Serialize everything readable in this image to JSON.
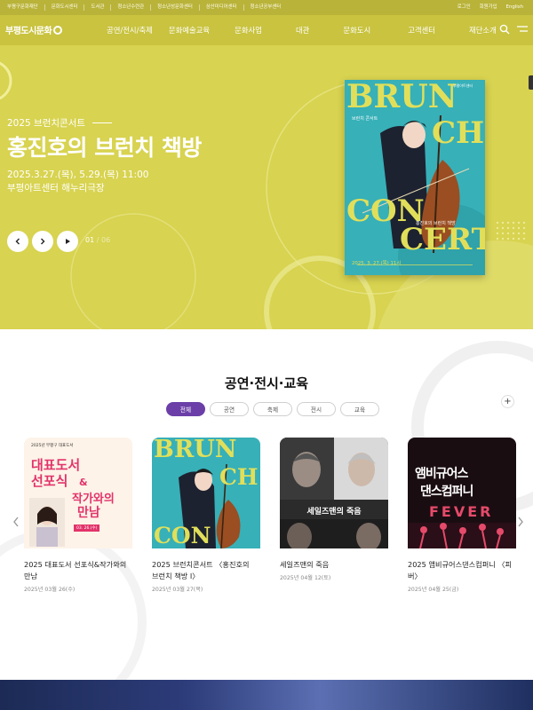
{
  "util_bar": {
    "left_links": [
      "부평구문화재단",
      "문화도시센터",
      "도서관",
      "청소년수련관",
      "청소년성문화센터",
      "삼산미디어센터",
      "청소년공부센터"
    ],
    "right_links": [
      "로그인",
      "회원가입",
      "English"
    ]
  },
  "nav": {
    "logo_text": "부평도시문화",
    "menu": [
      "공연/전시/축제",
      "문화예술교육",
      "문화사업",
      "대관",
      "문화도시",
      "고객센터",
      "재단소개"
    ]
  },
  "hero": {
    "subtitle": "2025 브런치콘서트",
    "title": "홍진호의 브런치 책방",
    "date": "2025.3.27.(목), 5.29.(목) 11:00",
    "venue": "부평아트센터 해누리극장",
    "counter_current": "01",
    "counter_total": "/ 06",
    "poster": {
      "big_1": "BRUN",
      "big_2": "CH",
      "big_3": "CON",
      "big_4": "CERT",
      "kicker": "브런치 콘서트",
      "program": "홍진호의 브런치 책방",
      "dates": "2025. 3. 27.(목) 11시",
      "logo": "부평아트센터"
    },
    "colors": {
      "background": "#d8d350",
      "poster_bg": "#37b0b8",
      "poster_text": "#e1df5a"
    }
  },
  "section": {
    "title": "공연·전시·교육",
    "filters": [
      "전체",
      "공연",
      "축제",
      "전시",
      "교육"
    ],
    "active_filter": "전체",
    "active_color": "#6b3fa7",
    "plus": "+",
    "cards": [
      {
        "title": "2025 대표도서 선포식&작가와의 만남",
        "date": "2025년 03월 26(수)",
        "poster": {
          "top": "2025년 부평구 대표도서",
          "l1": "대표도서",
          "l2": "선포식",
          "l3": "&",
          "l4": "작가와의",
          "l5": "만남",
          "date_chip": "03. 26.(수)"
        }
      },
      {
        "title": "2025 브런치콘서트 〈홍진호의 브런치 책방 Ⅰ〉",
        "date": "2025년 03월 27(목)",
        "poster": {
          "big_1": "BRUN",
          "big_2": "CH",
          "big_3": "CON"
        }
      },
      {
        "title": "세일즈맨의 죽음",
        "date": "2025년 04월 12(토)",
        "poster": {
          "title": "세일즈맨의 죽음"
        }
      },
      {
        "title": "2025 앰비규어스댄스컴퍼니 〈피버〉",
        "date": "2025년 04월 25(금)",
        "poster": {
          "l1": "앰비규어스",
          "l2": "댄스컴퍼니",
          "l3": "FEVER"
        }
      }
    ]
  },
  "icons": [
    "search-icon",
    "menu-icon",
    "prev-icon",
    "next-icon",
    "play-icon",
    "chevron-left-icon",
    "chevron-right-icon",
    "plus-icon"
  ]
}
